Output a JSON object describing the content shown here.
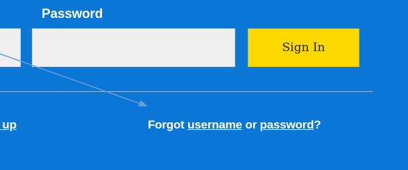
{
  "form": {
    "password_label": "Password",
    "password_value": "",
    "signin_label": "Sign In"
  },
  "links": {
    "signup_label": "Sign up",
    "forgot_prefix": "Forgot ",
    "username_label": "username",
    "or_text": " or ",
    "password_label": "password",
    "question_mark": "?"
  },
  "colors": {
    "panel_bg": "#0a77d6",
    "button_bg": "#fdd900",
    "annotation_arrow": "#6b9bd6"
  }
}
